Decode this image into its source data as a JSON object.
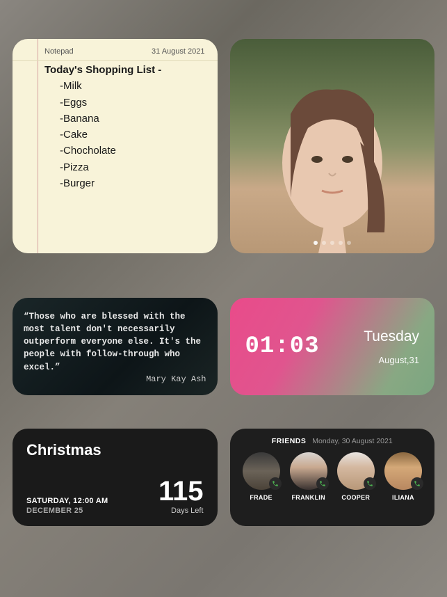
{
  "notepad": {
    "app_label": "Notepad",
    "date": "31 August 2021",
    "title": "Today's Shopping List -",
    "items": [
      "Milk",
      "Eggs",
      "Banana",
      "Cake",
      "Chocholate",
      "Pizza",
      "Burger"
    ]
  },
  "photo": {
    "page_dots": 5,
    "active_dot": 0
  },
  "quote": {
    "text": "“Those who are blessed with the most talent don't necessarily outperform everyone else. It's the people with follow-through who excel.”",
    "author": "Mary Kay Ash"
  },
  "clock": {
    "time": "01:03",
    "day": "Tuesday",
    "date": "August,31"
  },
  "countdown": {
    "event": "Christmas",
    "day_time": "SATURDAY, 12:00 AM",
    "date": "DECEMBER 25",
    "days": "115",
    "days_label": "Days Left"
  },
  "friends": {
    "title": "FRIENDS",
    "date": "Monday, 30 August 2021",
    "list": [
      {
        "name": "FRADE"
      },
      {
        "name": "FRANKLIN"
      },
      {
        "name": "COOPER"
      },
      {
        "name": "ILIANA"
      }
    ]
  }
}
